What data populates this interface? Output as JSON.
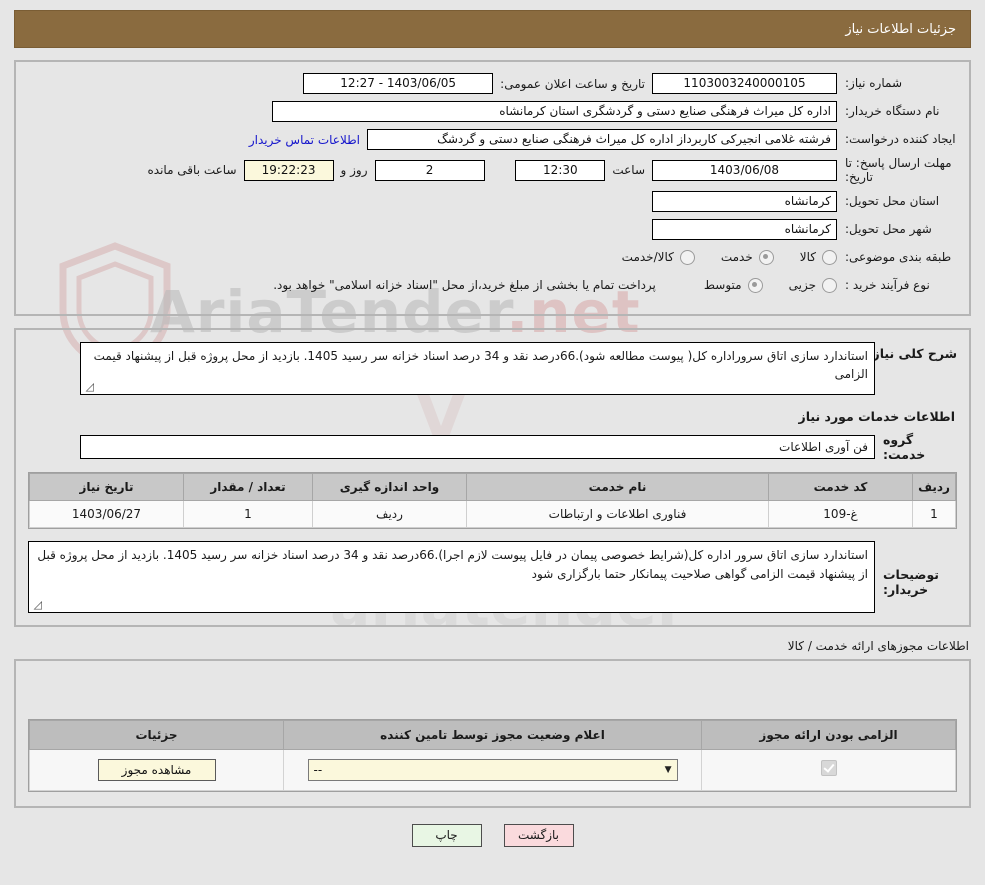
{
  "header": {
    "title": "جزئیات اطلاعات نیاز"
  },
  "form": {
    "need_number_label": "شماره نیاز:",
    "need_number_value": "1103003240000105",
    "announce_label": "تاریخ و ساعت اعلان عمومی:",
    "announce_value": "1403/06/05 - 12:27",
    "buyer_org_label": "نام دستگاه خریدار:",
    "buyer_org_value": "اداره کل میراث فرهنگی  صنایع دستی و گردشگری استان کرمانشاه",
    "creator_label": "ایجاد کننده درخواست:",
    "creator_value": "فرشته غلامی انجیرکی کاربرداز اداره کل میراث فرهنگی  صنایع دستی و گردشگ",
    "contact_link": "اطلاعات تماس خریدار",
    "deadline_label": "مهلت ارسال پاسخ: تا تاریخ:",
    "deadline_value": "1403/06/08",
    "hour_label": "ساعت",
    "hour_value": "12:30",
    "days_value": "2",
    "days_label": "روز و",
    "remaining_value": "19:22:23",
    "remaining_label": "ساعت باقی مانده",
    "province_label": "استان محل تحویل:",
    "province_value": "کرمانشاه",
    "city_label": "شهر محل تحویل:",
    "city_value": "کرمانشاه",
    "category_label": "طبقه بندی موضوعی:",
    "category_options": [
      {
        "label": "کالا",
        "selected": false
      },
      {
        "label": "خدمت",
        "selected": true
      },
      {
        "label": "کالا/خدمت",
        "selected": false
      }
    ],
    "process_label": "نوع فرآیند خرید :",
    "process_options": [
      {
        "label": "جزیی",
        "selected": false
      },
      {
        "label": "متوسط",
        "selected": true
      }
    ],
    "payment_note": "پرداخت تمام یا بخشی از مبلغ خرید،از محل \"اسناد خزانه اسلامی\" خواهد بود."
  },
  "description": {
    "label": "شرح کلی نیاز:",
    "value": "استاندارد سازی  اتاق سروراداره کل( پیوست مطالعه شود).66درصد نقد و 34 درصد اسناد خزانه سر رسید 1405. بازدید از محل پروژه قبل از پیشنهاد قیمت الزامی"
  },
  "services": {
    "section_title": "اطلاعات خدمات مورد نیاز",
    "group_label": "گروه خدمت:",
    "group_value": "فن آوری اطلاعات",
    "table": {
      "columns": [
        "ردیف",
        "کد خدمت",
        "نام خدمت",
        "واحد اندازه گیری",
        "تعداد / مقدار",
        "تاریخ نیاز"
      ],
      "rows": [
        [
          "1",
          "غ-109",
          "فناوری اطلاعات و ارتباطات",
          "ردیف",
          "1",
          "1403/06/27"
        ]
      ]
    }
  },
  "buyer_notes": {
    "label": "توضیحات خریدار:",
    "value": "استاندارد سازی  اتاق سرور اداره کل(شرایط خصوصی پیمان در فایل پیوست لازم اجرا).66درصد نقد و 34 درصد اسناد خزانه سر رسید 1405. بازدید از محل پروژه قبل از پیشنهاد قیمت الزامی گواهی صلاحیت پیمانکار حتما بارگزاری شود"
  },
  "permits": {
    "caption": "اطلاعات مجوزهای ارائه خدمت / کالا",
    "columns": [
      "الزامی بودن ارائه مجوز",
      "اعلام وضعیت مجوز توسط تامین کننده",
      "جزئیات"
    ],
    "row": {
      "required_checked": true,
      "status_value": "--",
      "details_button": "مشاهده مجوز"
    }
  },
  "footer": {
    "back_button": "بازگشت",
    "print_button": "چاپ"
  },
  "watermark": {
    "line1": "AriaTender",
    "line1_accent": ".net",
    "line2": "ariatender"
  }
}
